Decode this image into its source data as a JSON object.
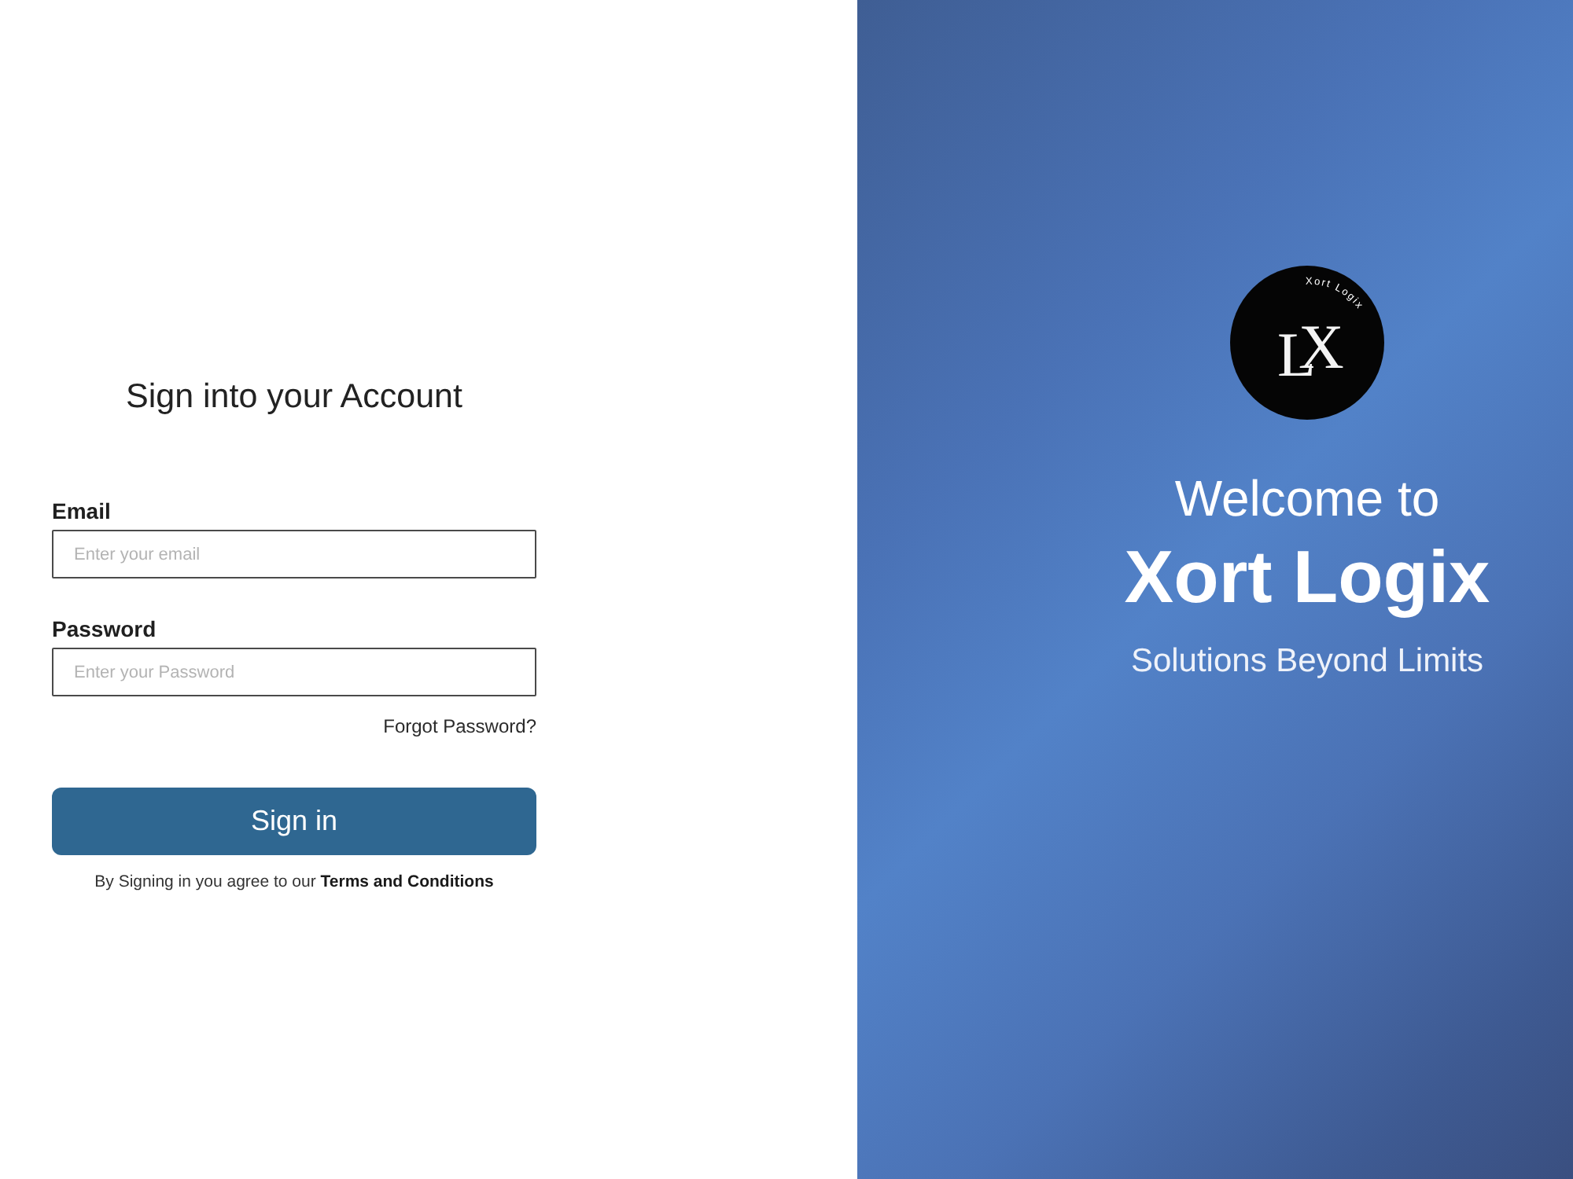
{
  "login": {
    "title": "Sign into your Account",
    "fields": [
      {
        "label": "Email",
        "placeholder": "Enter your email"
      },
      {
        "label": "Password",
        "placeholder": "Enter your Password"
      }
    ],
    "forgot_link": "Forgot Password?",
    "submit_button": "Sign in",
    "terms": {
      "text": "By Signing in you agree to our",
      "link": "Terms and Conditions"
    }
  },
  "brand": {
    "logo": {
      "monogram": "LX",
      "wordmark": "Xort Logix"
    },
    "welcome": "Welcome to",
    "name": "Xort Logix",
    "tagline": "Solutions Beyond Limits"
  }
}
